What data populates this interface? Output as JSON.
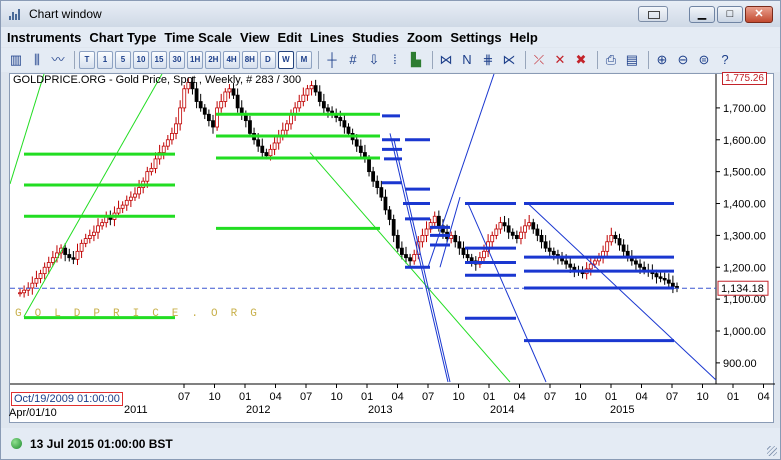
{
  "window": {
    "title": "Chart window"
  },
  "menu": [
    "Instruments",
    "Chart Type",
    "Time Scale",
    "View",
    "Edit",
    "Lines",
    "Studies",
    "Zoom",
    "Settings",
    "Help"
  ],
  "toolbar": {
    "timeframes": [
      "T",
      "1",
      "5",
      "10",
      "15",
      "30",
      "1H",
      "2H",
      "4H",
      "8H",
      "D",
      "W",
      "M"
    ],
    "active_timeframe": "W"
  },
  "chart": {
    "subtitle": "GOLDPRICE.ORG - Gold Price, Spot , Weekly, # 283 / 300",
    "top_right_value": "1,775.26",
    "current_price_label": "1,134.18",
    "watermark": "GOLDPRICE.ORG",
    "cursor_date": "Oct/19/2009 01:00:00",
    "first_date_label": "Apr/01/10",
    "colors": {
      "candle_up": "#c00000",
      "candle_down": "#000000",
      "bars": "#1a37d0",
      "green": "#22dd22",
      "price_line": "#3a57d0"
    }
  },
  "chart_data": {
    "type": "candlestick",
    "ylim": [
      840,
      1775
    ],
    "y_ticks": [
      "1,700.00",
      "1,600.00",
      "1,500.00",
      "1,400.00",
      "1,300.00",
      "1,200.00",
      "1,100.00",
      "1,000.00",
      "900.00"
    ],
    "y_tick_values": [
      1700,
      1600,
      1500,
      1400,
      1300,
      1200,
      1100,
      1000,
      900
    ],
    "x_month_labels": [
      "07",
      "10",
      "01",
      "04",
      "07",
      "10",
      "01",
      "04",
      "07",
      "10",
      "01",
      "04",
      "07",
      "10",
      "01",
      "04",
      "07",
      "10",
      "01",
      "04",
      "07",
      "10"
    ],
    "x_year_labels": [
      "2011",
      "2012",
      "2013",
      "2014",
      "2015"
    ],
    "current_price": 1134.18,
    "close_series": [
      1120,
      1128,
      1135,
      1150,
      1165,
      1180,
      1200,
      1215,
      1230,
      1245,
      1260,
      1240,
      1230,
      1225,
      1250,
      1275,
      1290,
      1300,
      1310,
      1330,
      1340,
      1360,
      1350,
      1370,
      1385,
      1395,
      1410,
      1420,
      1430,
      1450,
      1470,
      1500,
      1510,
      1540,
      1560,
      1580,
      1600,
      1620,
      1650,
      1700,
      1760,
      1780,
      1760,
      1720,
      1700,
      1680,
      1660,
      1640,
      1700,
      1720,
      1750,
      1760,
      1740,
      1700,
      1680,
      1660,
      1620,
      1600,
      1580,
      1560,
      1550,
      1570,
      1590,
      1610,
      1630,
      1650,
      1680,
      1700,
      1720,
      1740,
      1760,
      1770,
      1750,
      1720,
      1700,
      1690,
      1680,
      1670,
      1660,
      1640,
      1620,
      1600,
      1580,
      1560,
      1540,
      1500,
      1470,
      1450,
      1420,
      1380,
      1350,
      1300,
      1260,
      1240,
      1230,
      1220,
      1240,
      1280,
      1300,
      1320,
      1340,
      1360,
      1330,
      1310,
      1290,
      1300,
      1280,
      1260,
      1240,
      1230,
      1220,
      1210,
      1230,
      1250,
      1280,
      1300,
      1320,
      1340,
      1330,
      1310,
      1300,
      1290,
      1310,
      1330,
      1340,
      1320,
      1300,
      1280,
      1260,
      1250,
      1240,
      1230,
      1220,
      1210,
      1200,
      1190,
      1185,
      1180,
      1195,
      1210,
      1220,
      1230,
      1250,
      1280,
      1300,
      1290,
      1270,
      1250,
      1230,
      1220,
      1210,
      1200,
      1190,
      1185,
      1180,
      1170,
      1165,
      1160,
      1150,
      1140,
      1134
    ]
  }
}
